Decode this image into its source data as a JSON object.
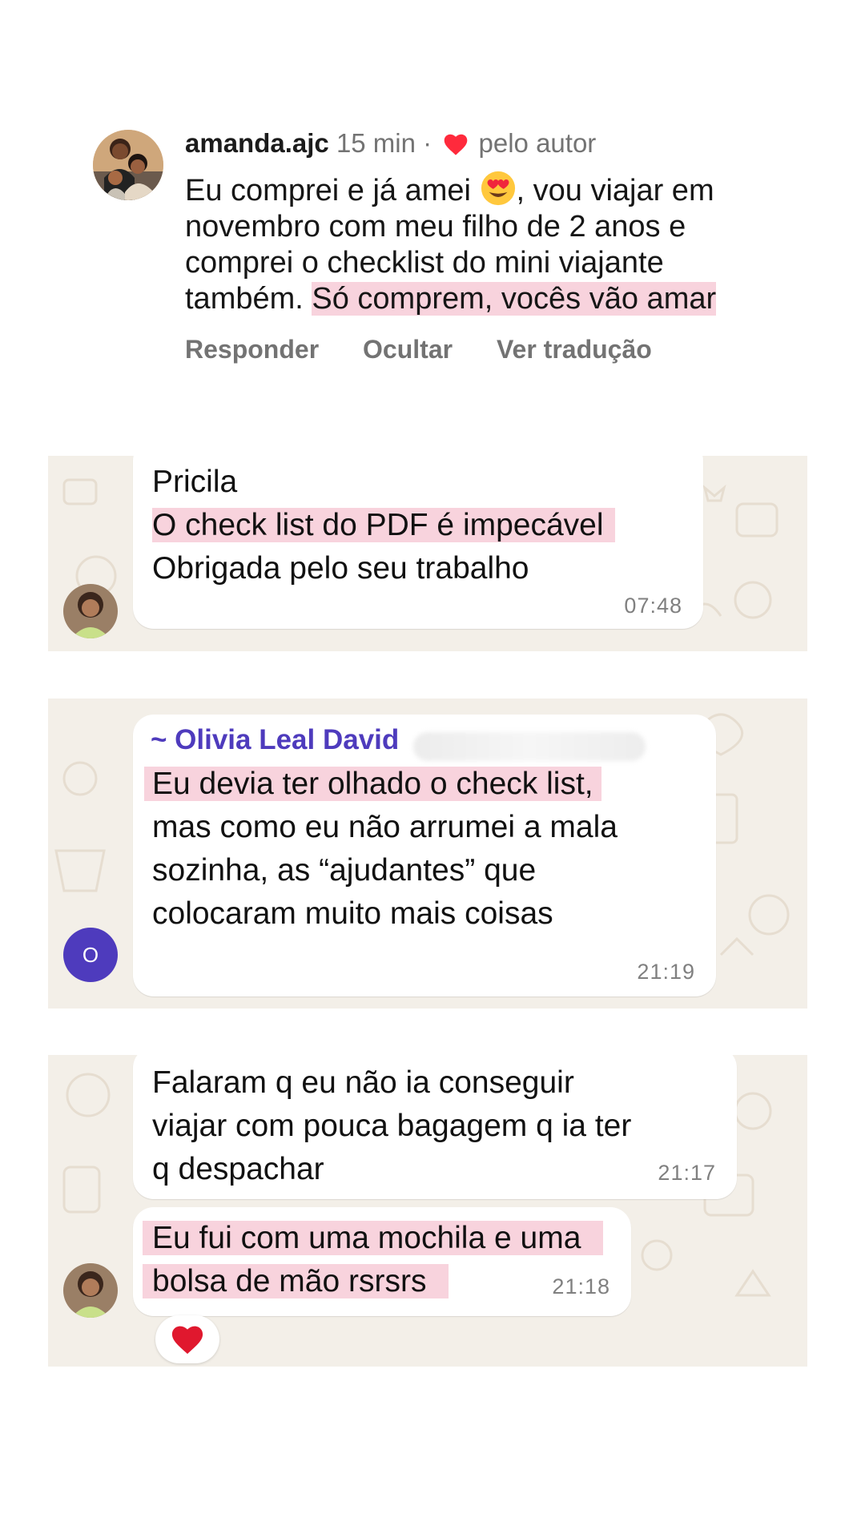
{
  "instagram_comment": {
    "username": "amanda.ajc",
    "time": "15 min",
    "separator": "·",
    "liked_by_author": "pelo autor",
    "text_part1": "Eu comprei e já amei",
    "text_part2": ", vou viajar em",
    "text_line2": "novembro com meu filho de 2 anos e",
    "text_line3": "comprei o checklist do mini viajante",
    "text_line4_plain": "também.",
    "text_line4_highlight": "Só comprem, vocês vão amar",
    "emoji": "heart-eyes-emoji",
    "actions": {
      "reply": "Responder",
      "hide": "Ocultar",
      "translate": "Ver tradução"
    }
  },
  "chat1": {
    "lines": [
      "Pricila",
      "O check list do PDF é impecável",
      "Obrigada pelo seu trabalho"
    ],
    "time": "07:48"
  },
  "chat2": {
    "sender": "~ Olivia Leal David",
    "sender_avatar_letter": "O",
    "lines": [
      "Eu devia ter olhado o check list,",
      "mas como eu não arrumei a mala",
      "sozinha, as “ajudantes” que",
      "colocaram muito mais coisas"
    ],
    "time": "21:19"
  },
  "chat3": {
    "message1": {
      "lines": [
        "Falaram q eu não ia conseguir",
        "viajar com pouca bagagem q ia ter",
        "q despachar"
      ],
      "time": "21:17"
    },
    "message2": {
      "lines": [
        "Eu fui com uma mochila e uma",
        "bolsa de mão rsrsrs"
      ],
      "time": "21:18"
    },
    "reaction": "❤️"
  },
  "colors": {
    "highlight": "#f8d3dd",
    "sender_name": "#4e3bbd",
    "wa_background": "#f3efe8",
    "heart": "#ff2a3c"
  }
}
